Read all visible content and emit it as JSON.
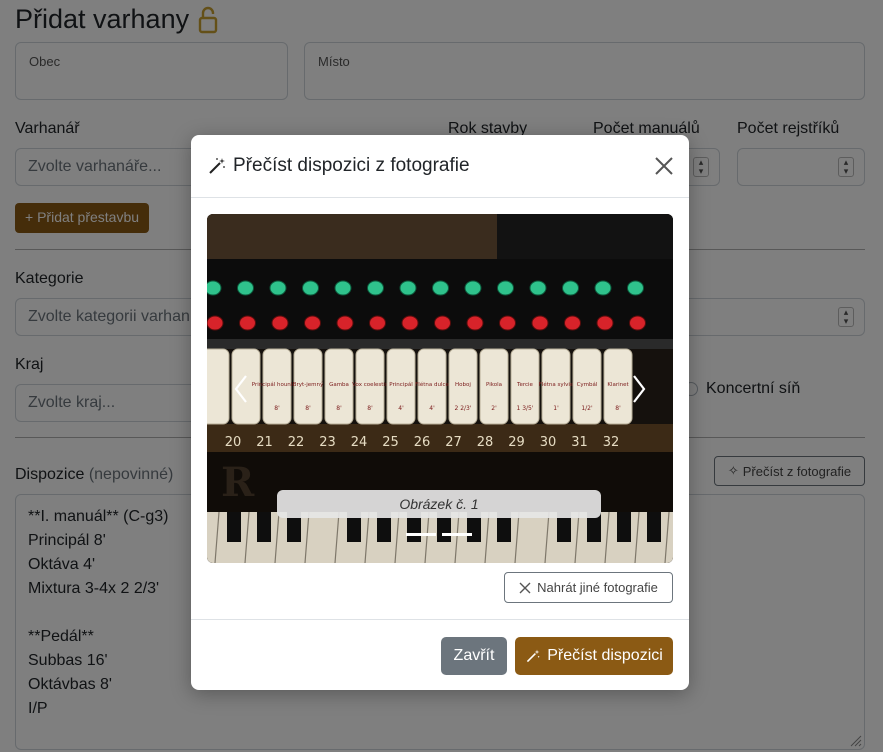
{
  "page": {
    "title": "Přidat varhany",
    "fields": {
      "obec_label": "Obec",
      "misto_label": "Místo",
      "varhanar_label": "Varhanář",
      "varhanar_placeholder": "Zvolte varhanáře...",
      "rok_label": "Rok stavby",
      "manualu_label": "Počet manuálů",
      "rejstriku_label": "Počet rejstříků",
      "pridat_prestavbu": "Přidat přestavbu",
      "kategorie_label": "Kategorie",
      "kategorie_placeholder": "Zvolte kategorii varhan",
      "kraj_label": "Kraj",
      "kraj_placeholder": "Zvolte kraj...",
      "koncertni_sin": "Koncertní síň",
      "dispozice_label": "Dispozice",
      "dispozice_optional": "(nepovinné)",
      "precist_z_fotografie": "Přečíst z fotografie"
    },
    "dispozice_lines": [
      "**I. manuál** (C-g3)",
      "Principál 8'",
      "Oktáva 4'",
      "Mixtura 3-4x 2 2/3'",
      "",
      "**Pedál**",
      "Subbas 16'",
      "Oktávbas 8'",
      "I/P"
    ]
  },
  "modal": {
    "title": "Přečíst dispozici z fotografie",
    "caption": "Obrázek č. 1",
    "upload_other": "Nahrát jiné fotografie",
    "close_button": "Zavřít",
    "read_button": "Přečíst dispozici",
    "photo_numbers": [
      "20",
      "21",
      "22",
      "23",
      "24",
      "25",
      "26",
      "27",
      "28",
      "29",
      "30",
      "31",
      "32"
    ],
    "stop_labels": [
      "Principál hounlový",
      "Bryt-jemný",
      "Gamba",
      "Vox coelestis",
      "Principál",
      "Flétna dulce",
      "Hoboj",
      "Pikola",
      "Tercie",
      "Flétna sylvie",
      "Cymbál",
      "Klarinet"
    ],
    "stop_sizes": [
      "8'",
      "8'",
      "8'",
      "8'",
      "4'",
      "4'",
      "2 2/3'",
      "2'",
      "1 3/5'",
      "1'",
      "1/2'",
      "8'"
    ]
  },
  "colors": {
    "brand": "#8b5a14",
    "secondary": "#6c757d",
    "lock": "#c8a030"
  },
  "icons": [
    "lock-icon",
    "magic-wand-icon",
    "close-icon",
    "chevron-left-icon",
    "chevron-right-icon",
    "x-icon",
    "plus-icon",
    "spinner-icon",
    "resize-grip-icon"
  ]
}
